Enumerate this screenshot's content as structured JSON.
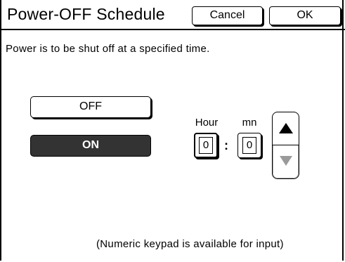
{
  "header": {
    "title": "Power-OFF Schedule",
    "cancel_label": "Cancel",
    "ok_label": "OK"
  },
  "description": "Power is to be shut off at a specified time.",
  "toggle": {
    "off_label": "OFF",
    "on_label": "ON",
    "selected": "ON"
  },
  "time": {
    "hour_label": "Hour",
    "mn_label": "mn",
    "hour_value": "0",
    "mn_value": "0",
    "separator": ":"
  },
  "stepper": {
    "up_icon": "triangle-up-icon",
    "down_icon": "triangle-down-icon"
  },
  "footer_note": "(Numeric keypad is available for input)",
  "colors": {
    "selected_fill": "#333333",
    "disabled_arrow": "#9a9a9a"
  }
}
